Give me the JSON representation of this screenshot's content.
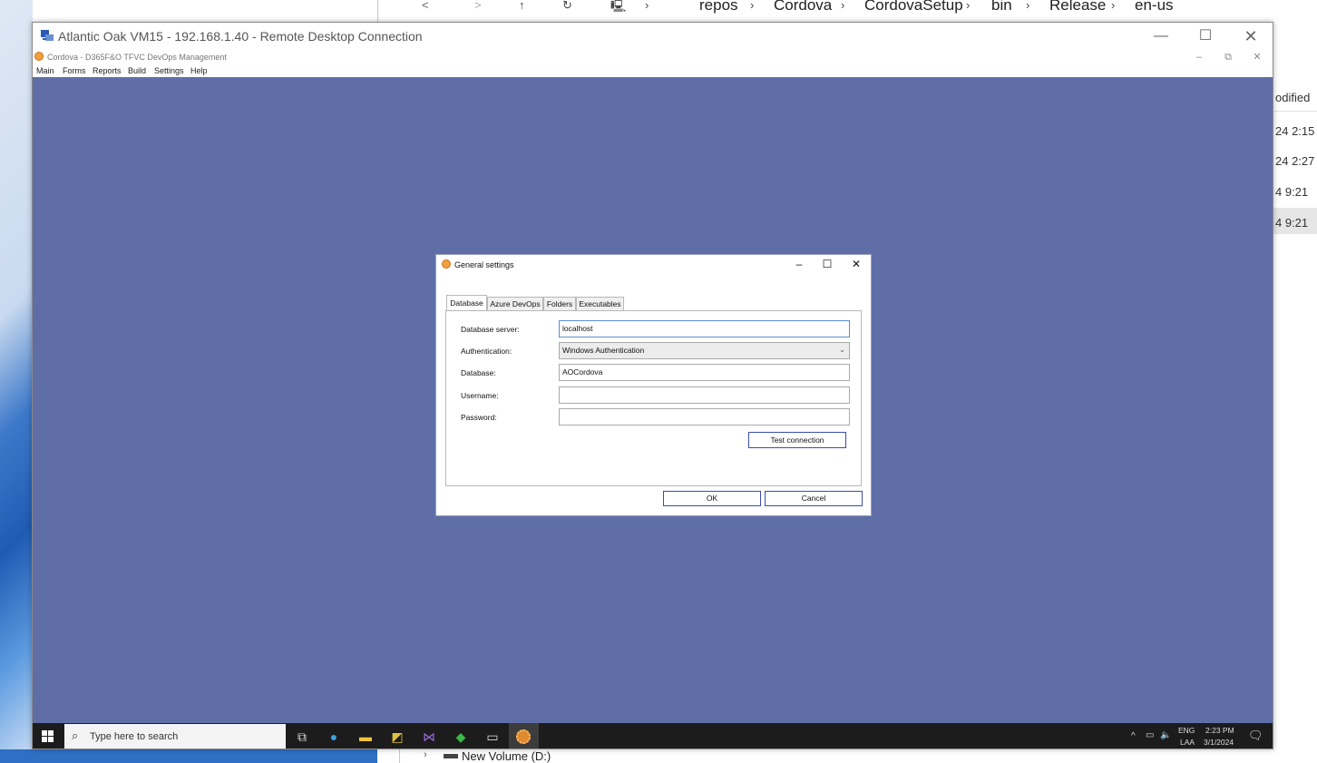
{
  "explorer": {
    "breadcrumbs": [
      "repos",
      "Cordova",
      "CordovaSetup",
      "bin",
      "Release",
      "en-us"
    ],
    "column_header": "odified",
    "dates": [
      "24 2:15",
      "24 2:27",
      "4 9:21",
      "4 9:21"
    ],
    "bottom_item": "New Volume (D:)"
  },
  "rdp": {
    "title": "Atlantic Oak VM15 - 192.168.1.40 - Remote Desktop Connection"
  },
  "app": {
    "title": "Cordova - D365F&O TFVC DevOps Management",
    "menu": [
      "Main",
      "Forms",
      "Reports",
      "Build",
      "Settings",
      "Help"
    ]
  },
  "dialog": {
    "title": "General settings",
    "tabs": [
      "Database",
      "Azure DevOps",
      "Folders",
      "Executables"
    ],
    "fields": {
      "server_label": "Database server:",
      "server_value": "localhost",
      "auth_label": "Authentication:",
      "auth_value": "Windows Authentication",
      "db_label": "Database:",
      "db_value": "AOCordova",
      "user_label": "Username:",
      "user_value": "",
      "pass_label": "Password:",
      "pass_value": ""
    },
    "test_button": "Test connection",
    "ok_button": "OK",
    "cancel_button": "Cancel"
  },
  "taskbar": {
    "search_placeholder": "Type here to search",
    "lang": "ENG",
    "layout": "LAA",
    "time": "2:23 PM",
    "date": "3/1/2024"
  },
  "colors": {
    "desktop": "#5f6ea6",
    "taskbar": "#1c1c1c",
    "button_border": "#3b4db0"
  }
}
